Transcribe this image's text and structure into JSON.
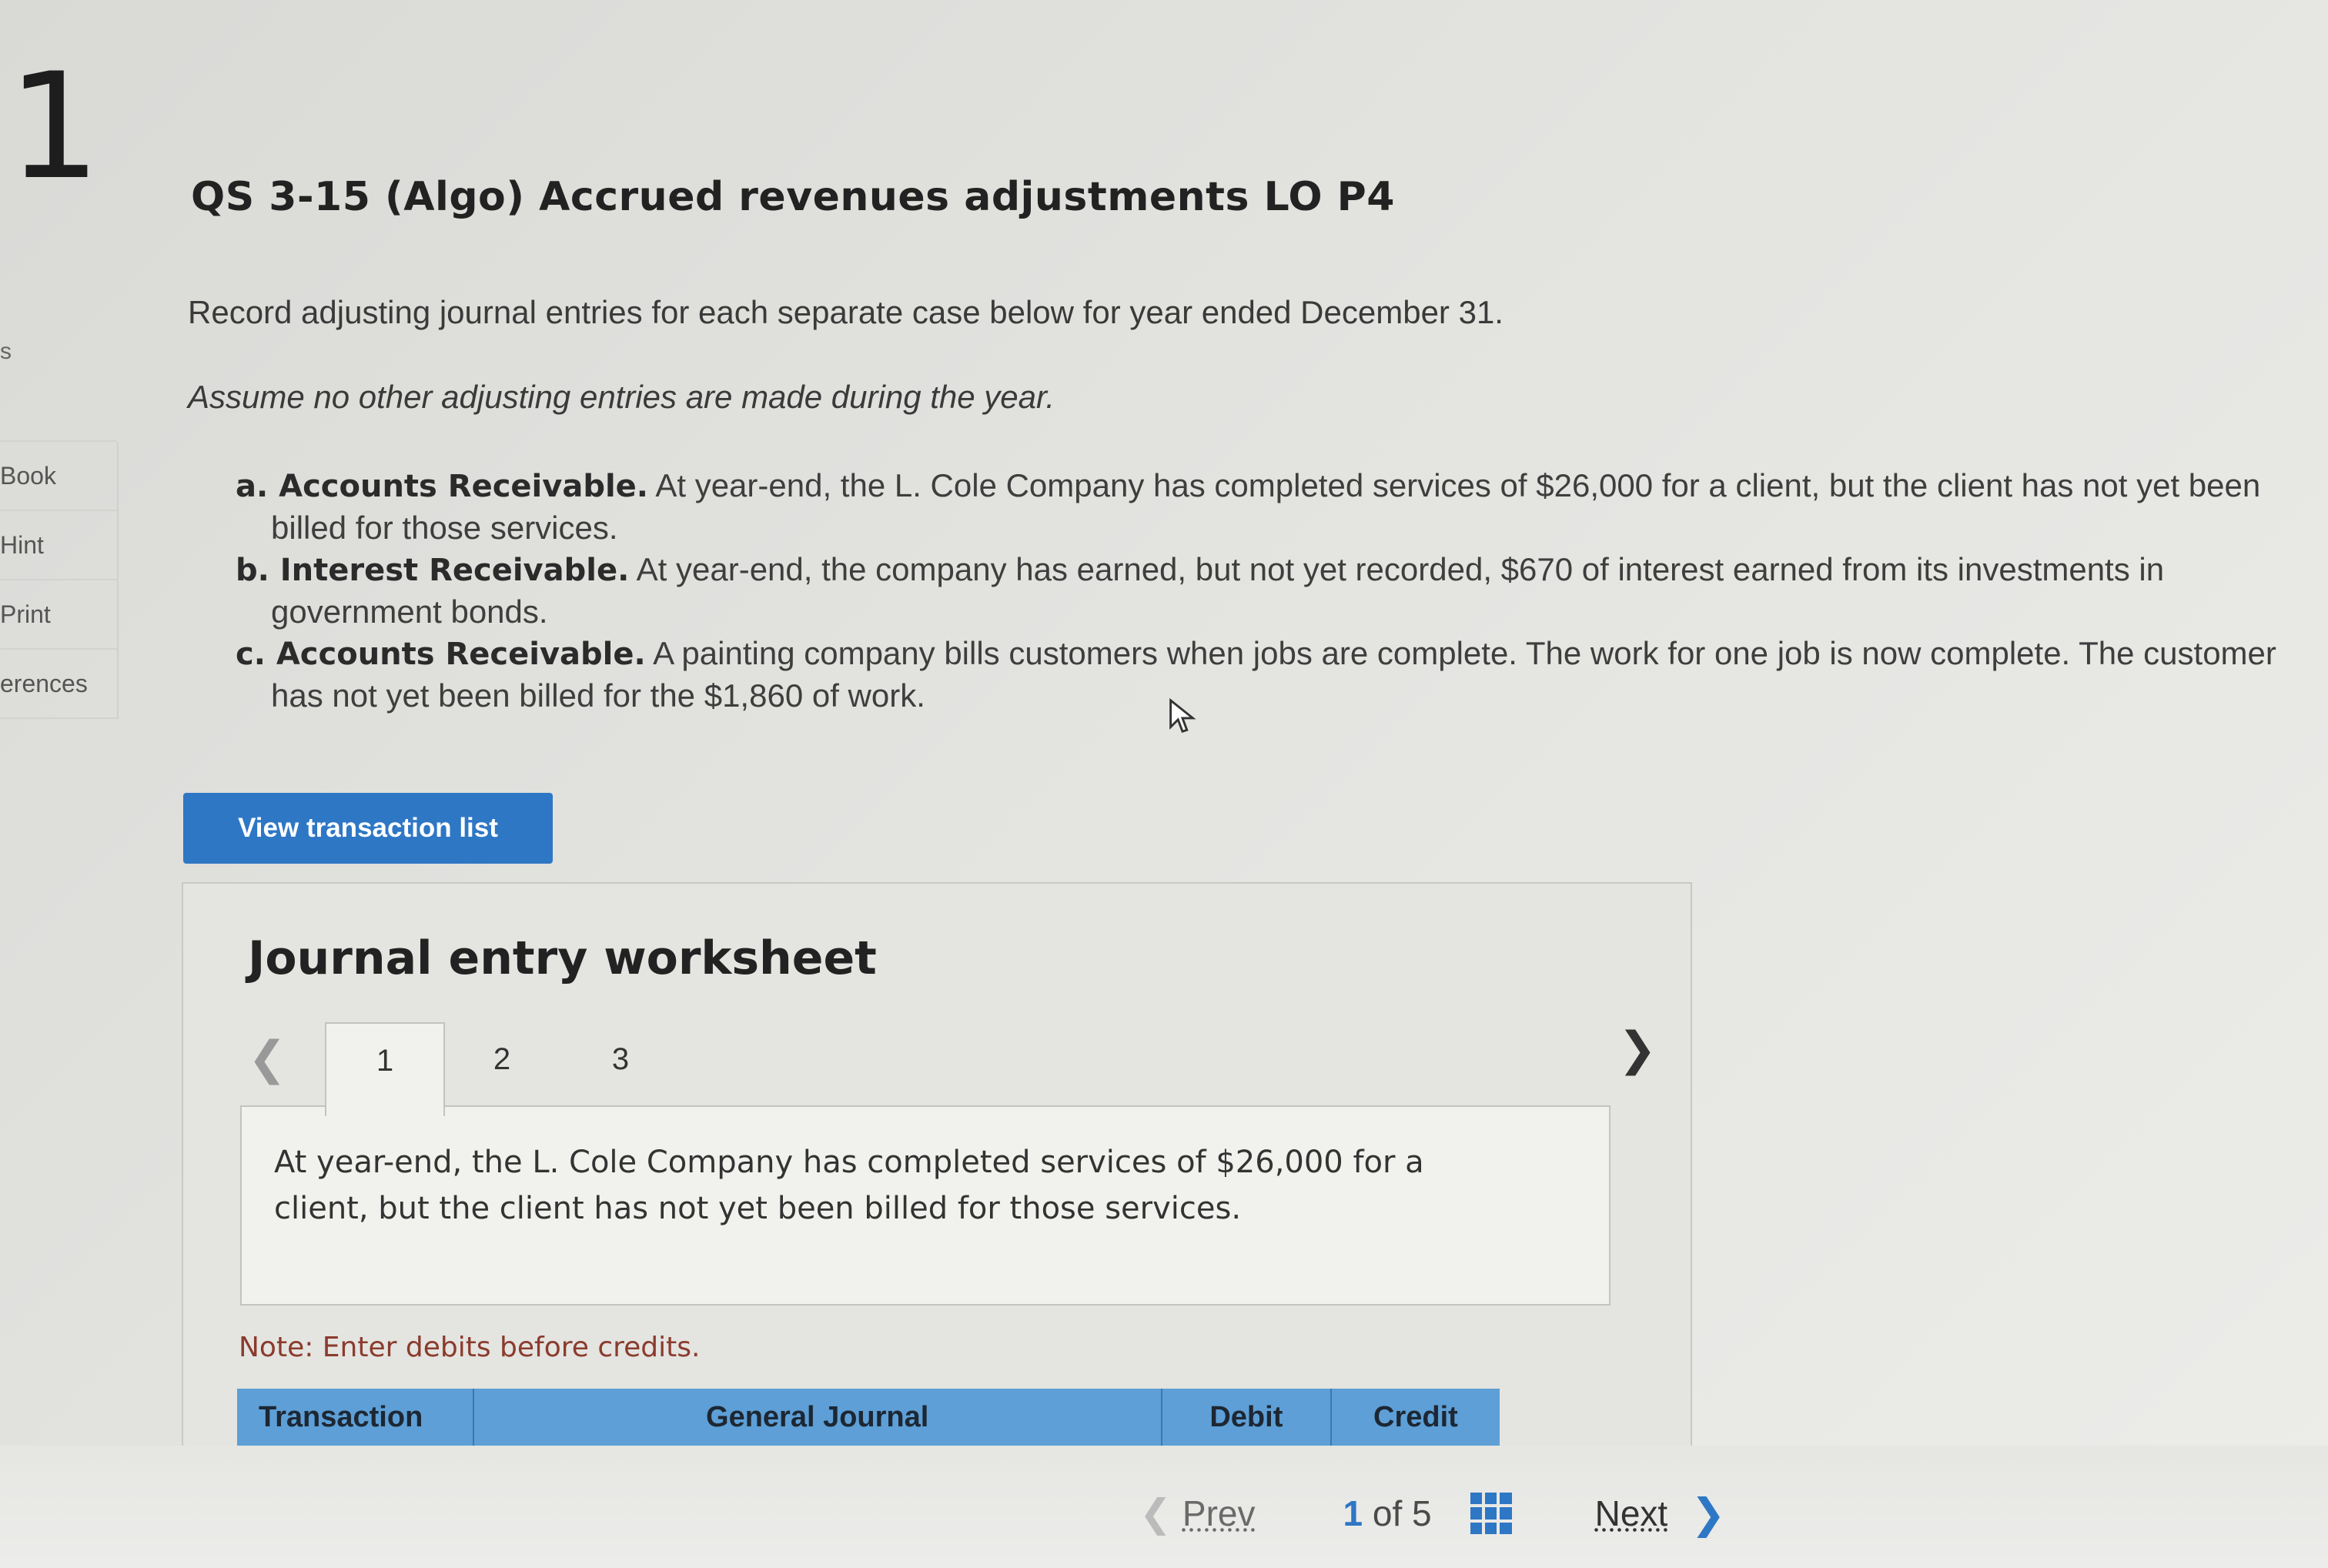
{
  "question_number": "1",
  "sidebar": {
    "partial_top_label": "s",
    "items": [
      "Book",
      "Hint",
      "Print",
      "erences"
    ]
  },
  "question": {
    "title": "QS 3-15 (Algo) Accrued revenues adjustments LO P4",
    "intro": "Record adjusting journal entries for each separate case below for year ended December 31.",
    "assumption": "Assume no other adjusting entries are made during the year.",
    "cases": [
      {
        "label": "a. Accounts Receivable.",
        "text": " At year-end, the L. Cole Company has completed services of $26,000 for a client, but the client has not yet been billed for those services."
      },
      {
        "label": "b. Interest Receivable.",
        "text": " At year-end, the company has earned, but not yet recorded, $670 of interest earned from its investments in government bonds."
      },
      {
        "label": "c. Accounts Receivable.",
        "text": " A painting company bills customers when jobs are complete. The work for one job is now complete. The customer has not yet been billed for the $1,860 of work."
      }
    ]
  },
  "view_transaction_button": "View transaction list",
  "worksheet": {
    "title": "Journal entry worksheet",
    "tabs": [
      "1",
      "2",
      "3"
    ],
    "active_tab": "1",
    "description": "At year-end, the L. Cole Company has completed services of $26,000 for a client, but the client has not yet been billed for those services.",
    "note": "Note: Enter debits before credits.",
    "table_headers": [
      "Transaction",
      "General Journal",
      "Debit",
      "Credit"
    ]
  },
  "pager": {
    "prev": "Prev",
    "current": "1",
    "of": "of",
    "total": "5",
    "next": "Next"
  },
  "icons": {
    "prev_arrow": "chevron-left-icon",
    "next_arrow": "chevron-right-icon",
    "grid": "grid-icon",
    "cursor": "mouse-pointer-icon"
  },
  "colors": {
    "accent_blue": "#2e77c5",
    "table_header_blue": "#5d9fd6",
    "note_red": "#8a3b2c"
  }
}
